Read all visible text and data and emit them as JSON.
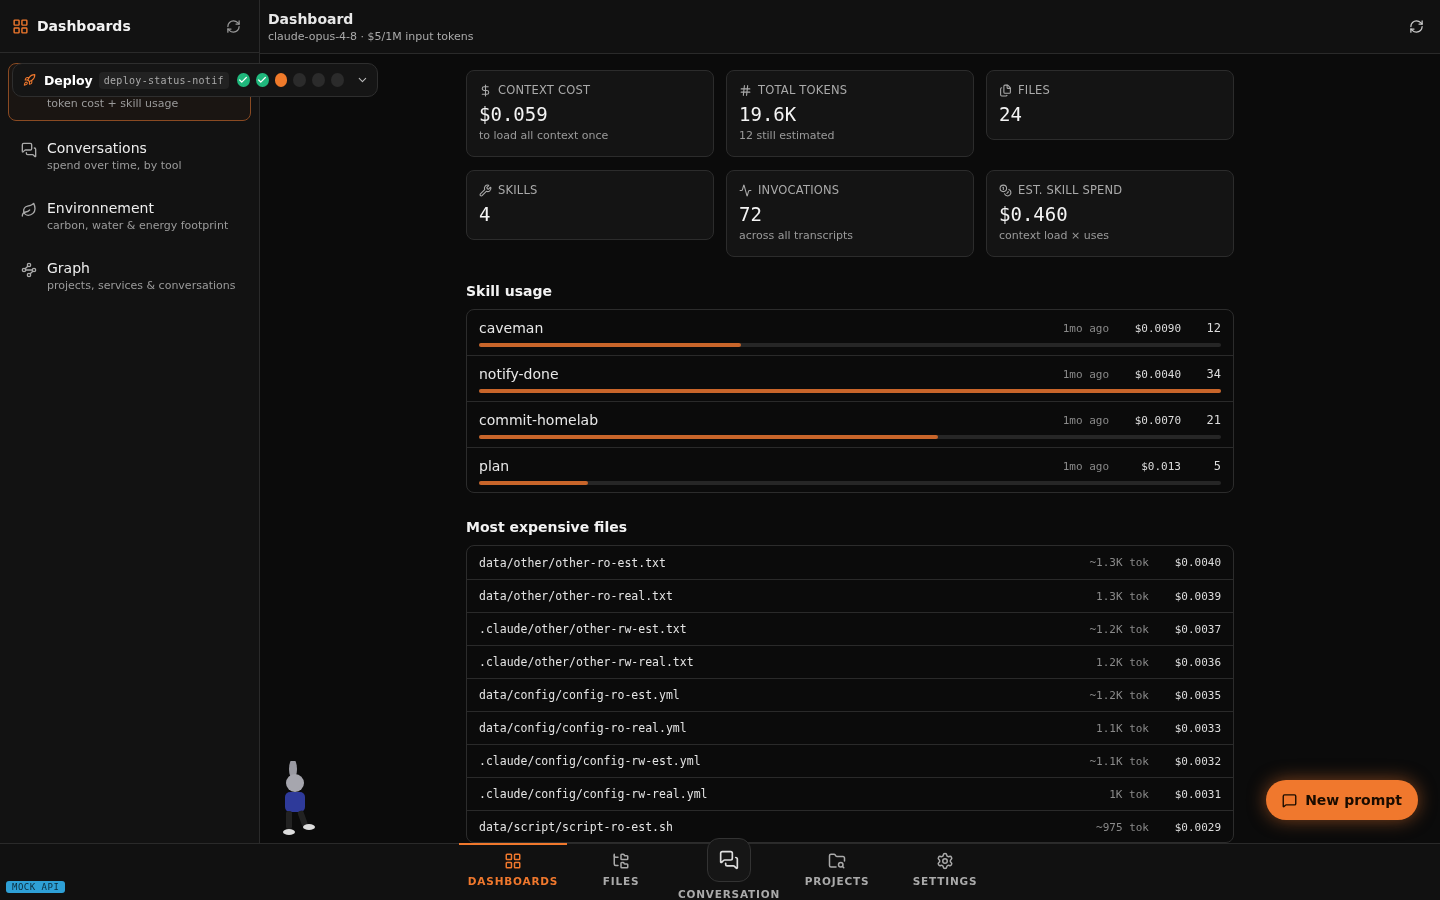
{
  "sidebar": {
    "title": "Dashboards",
    "items": [
      {
        "subtitle": "token cost + skill usage",
        "selected": true
      },
      {
        "title": "Conversations",
        "subtitle": "spend over time, by tool",
        "selected": false
      },
      {
        "title": "Environnement",
        "subtitle": "carbon, water & energy footprint",
        "selected": false
      },
      {
        "title": "Graph",
        "subtitle": "projects, services & conversations",
        "selected": false
      }
    ]
  },
  "deploy": {
    "label": "Deploy",
    "branch": "deploy-status-notif",
    "expanded": false,
    "runs": [
      {
        "kind": "success"
      },
      {
        "kind": "success"
      },
      {
        "kind": "running"
      },
      {
        "kind": "pending"
      },
      {
        "kind": "pending"
      },
      {
        "kind": "pending"
      }
    ]
  },
  "header": {
    "title": "Dashboard",
    "subtitle": "claude-opus-4-8 · $5/1M input tokens"
  },
  "stats": [
    {
      "label": "CONTEXT COST",
      "value": "$0.059",
      "note": "to load all context once"
    },
    {
      "label": "TOTAL TOKENS",
      "value": "19.6K",
      "note": "12 still estimated"
    },
    {
      "label": "FILES",
      "value": "24"
    },
    {
      "label": "SKILLS",
      "value": "4"
    },
    {
      "label": "INVOCATIONS",
      "value": "72",
      "note": "across all transcripts"
    },
    {
      "label": "EST. SKILL SPEND",
      "value": "$0.460",
      "note": "context load × uses"
    }
  ],
  "skill_usage": {
    "title": "Skill usage",
    "rows": [
      {
        "name": "caveman",
        "ago": "1mo ago",
        "cost": "$0.0090",
        "count": "12",
        "level": 0.353
      },
      {
        "name": "notify-done",
        "ago": "1mo ago",
        "cost": "$0.0040",
        "count": "34",
        "level": 1
      },
      {
        "name": "commit-homelab",
        "ago": "1mo ago",
        "cost": "$0.0070",
        "count": "21",
        "level": 0.618
      },
      {
        "name": "plan",
        "ago": "1mo ago",
        "cost": "$0.013",
        "count": "5",
        "level": 0.147
      }
    ]
  },
  "expensive_files": {
    "title": "Most expensive files",
    "rows": [
      {
        "path": "data/other/other-ro-est.txt",
        "tokens": "~1.3K tok",
        "cost": "$0.0040"
      },
      {
        "path": "data/other/other-ro-real.txt",
        "tokens": "1.3K tok",
        "cost": "$0.0039"
      },
      {
        "path": ".claude/other/other-rw-est.txt",
        "tokens": "~1.2K tok",
        "cost": "$0.0037"
      },
      {
        "path": ".claude/other/other-rw-real.txt",
        "tokens": "1.2K tok",
        "cost": "$0.0036"
      },
      {
        "path": "data/config/config-ro-est.yml",
        "tokens": "~1.2K tok",
        "cost": "$0.0035"
      },
      {
        "path": "data/config/config-ro-real.yml",
        "tokens": "1.1K tok",
        "cost": "$0.0033"
      },
      {
        "path": ".claude/config/config-rw-est.yml",
        "tokens": "~1.1K tok",
        "cost": "$0.0032"
      },
      {
        "path": ".claude/config/config-rw-real.yml",
        "tokens": "1K tok",
        "cost": "$0.0031"
      },
      {
        "path": "data/script/script-ro-est.sh",
        "tokens": "~975 tok",
        "cost": "$0.0029"
      }
    ]
  },
  "new_prompt": "New prompt",
  "badge": "MOCK API",
  "nav": [
    {
      "label": "DASHBOARDS",
      "kind": "tab",
      "selected": true
    },
    {
      "label": "FILES",
      "kind": "tab",
      "selected": false
    },
    {
      "label": "CONVERSATION",
      "kind": "raised",
      "selected": false
    },
    {
      "label": "PROJECTS",
      "kind": "tab",
      "selected": false
    },
    {
      "label": "SETTINGS",
      "kind": "tab",
      "selected": false
    }
  ]
}
